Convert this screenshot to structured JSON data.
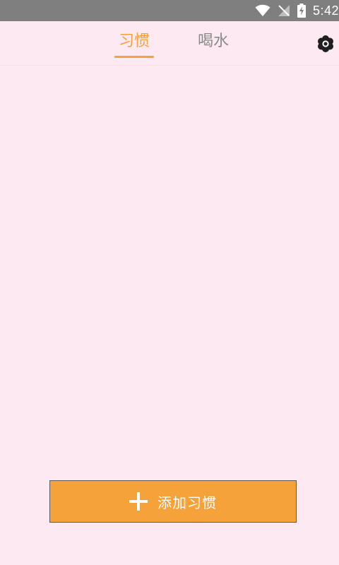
{
  "status_bar": {
    "time": "5:42",
    "icons": [
      "wifi-icon",
      "no-signal-icon",
      "battery-charging-icon"
    ]
  },
  "tabs": [
    {
      "label": "习惯",
      "active": true
    },
    {
      "label": "喝水",
      "active": false
    }
  ],
  "header": {
    "settings_icon": "gear-icon"
  },
  "actions": {
    "add_habit_label": "添加习惯",
    "add_icon": "plus-icon"
  },
  "colors": {
    "background": "#fce9f1",
    "accent": "#f5a23a",
    "inactive_tab": "#8a8a8a",
    "status_bar": "#7f7f7f"
  }
}
